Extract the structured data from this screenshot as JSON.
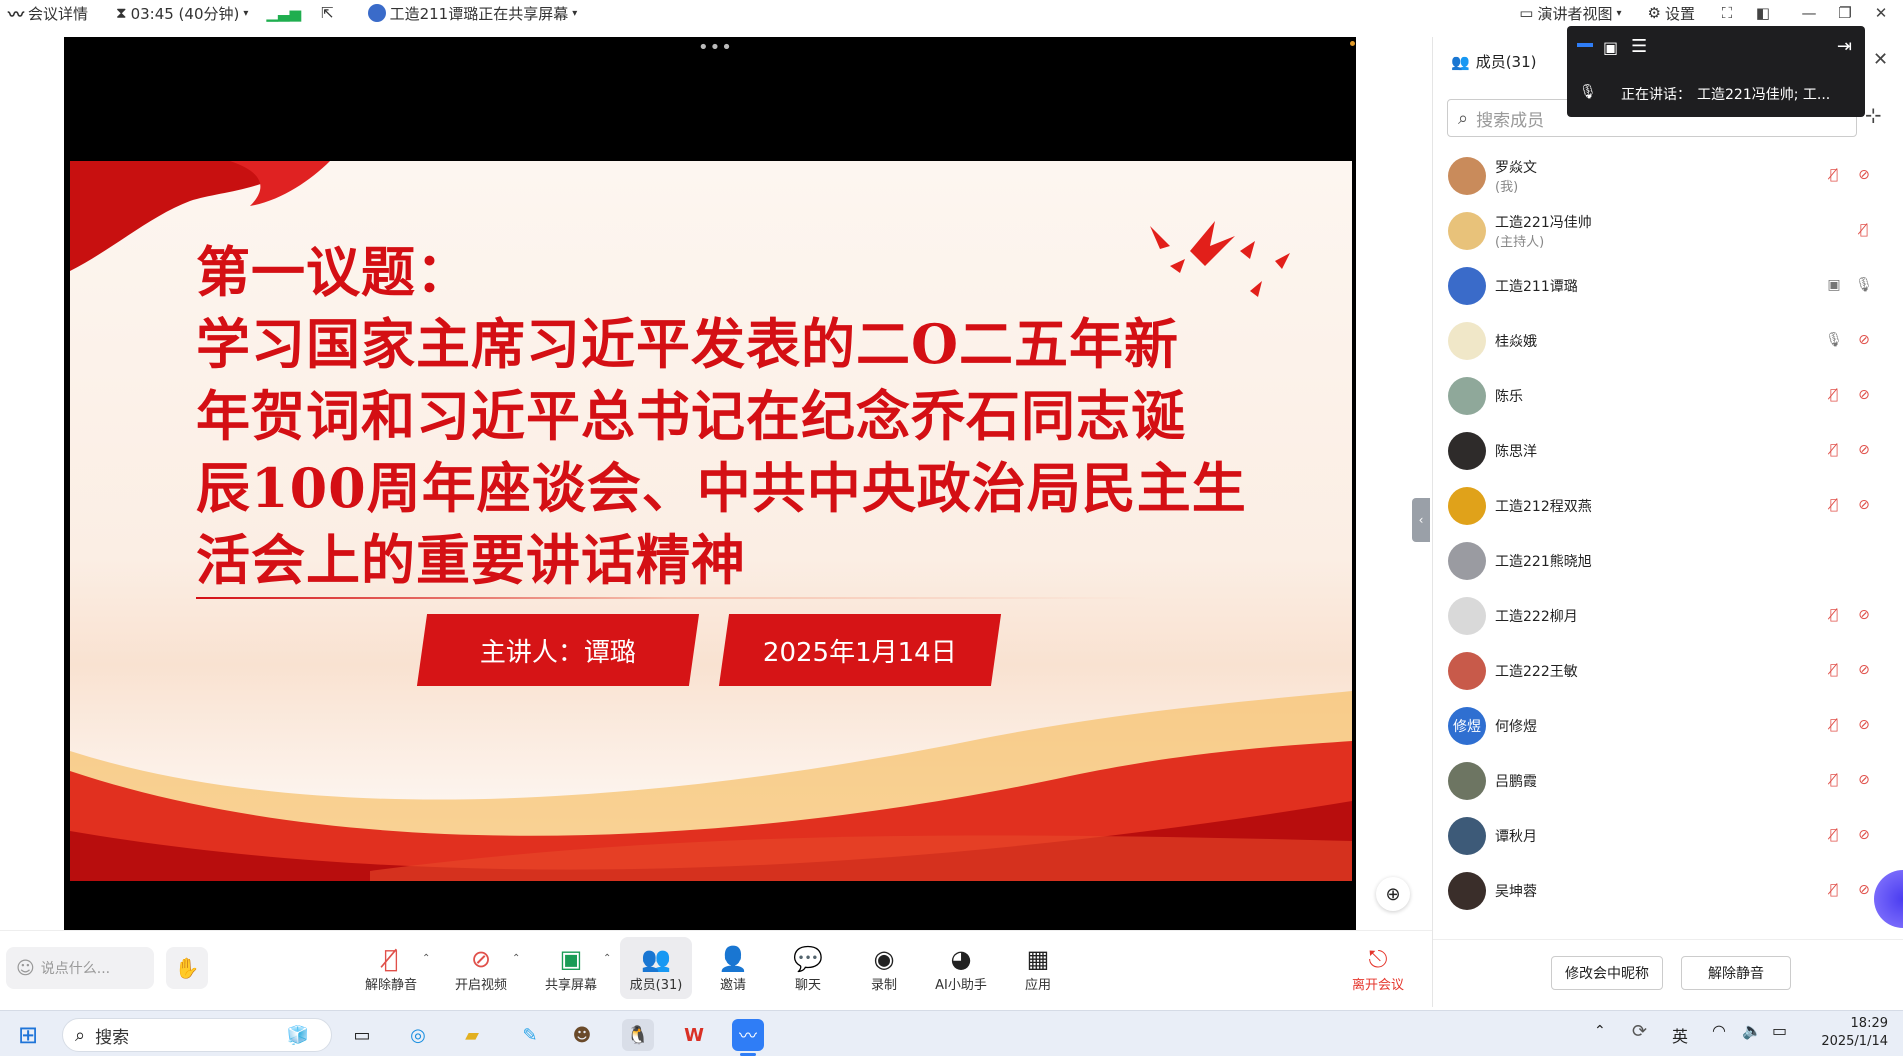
{
  "topbar": {
    "meeting_details": "会议详情",
    "timer": "03:45 (40分钟)",
    "sharing_status": "工造211谭璐正在共享屏幕",
    "speaker_view": "演讲者视图",
    "settings": "设置"
  },
  "slide": {
    "title_lines": [
      "第一议题：",
      "学习国家主席习近平发表的二O二五年新",
      "年贺词和习近平总书记在纪念乔石同志诞",
      "辰100周年座谈会、中共中央政治局民主生",
      "活会上的重要讲话精神"
    ],
    "presenter": "主讲人：谭璐",
    "date": "2025年1月14日"
  },
  "floating": {
    "speaking_label": "正在讲话：",
    "speaking_names": "工造221冯佳帅; 工..."
  },
  "panel": {
    "members_tab": "成员(31)",
    "search_placeholder": "搜索成员",
    "members": [
      {
        "name": "罗焱文",
        "role": "(我)",
        "avatar_color": "#c98b5b"
      },
      {
        "name": "工造221冯佳帅",
        "role": "(主持人)",
        "avatar_color": "#e8c27a"
      },
      {
        "name": "工造211谭璐",
        "role": "",
        "avatar_color": "#3a6bc9"
      },
      {
        "name": "桂焱娥",
        "role": "",
        "avatar_color": "#f0e7c8"
      },
      {
        "name": "陈乐",
        "role": "",
        "avatar_color": "#8fa89a"
      },
      {
        "name": "陈思洋",
        "role": "",
        "avatar_color": "#2e2b2a"
      },
      {
        "name": "工造212程双燕",
        "role": "",
        "avatar_color": "#e0a21a"
      },
      {
        "name": "工造221熊晓旭",
        "role": "",
        "avatar_color": "#9a9ba1"
      },
      {
        "name": "工造222柳月",
        "role": "",
        "avatar_color": "#d9d9d9"
      },
      {
        "name": "工造222王敏",
        "role": "",
        "avatar_color": "#c85a4a"
      },
      {
        "name": "何修煜",
        "role": "",
        "avatar_text": "修煜",
        "avatar_color": "#2f6fd1"
      },
      {
        "name": "吕鹏霞",
        "role": "",
        "avatar_color": "#6d7562"
      },
      {
        "name": "谭秋月",
        "role": "",
        "avatar_color": "#3d5a78"
      },
      {
        "name": "吴坤蓉",
        "role": "",
        "avatar_color": "#3a2e2a"
      }
    ],
    "rename_button": "修改会中昵称",
    "unmute_all_button": "解除静音"
  },
  "toolbar": {
    "chat_placeholder": "说点什么...",
    "unmute": "解除静音",
    "start_video": "开启视频",
    "share_screen": "共享屏幕",
    "members": "成员(31)",
    "invite": "邀请",
    "chat": "聊天",
    "record": "录制",
    "ai_assistant": "AI小助手",
    "apps": "应用",
    "leave": "离开会议"
  },
  "taskbar": {
    "search_placeholder": "搜索",
    "ime": "英",
    "time": "18:29",
    "date": "2025/1/14"
  },
  "colors": {
    "slide_red": "#d40f14",
    "accent_blue": "#2f6fd1",
    "leave_red": "#e5362c",
    "muted_red": "#e0504a"
  }
}
